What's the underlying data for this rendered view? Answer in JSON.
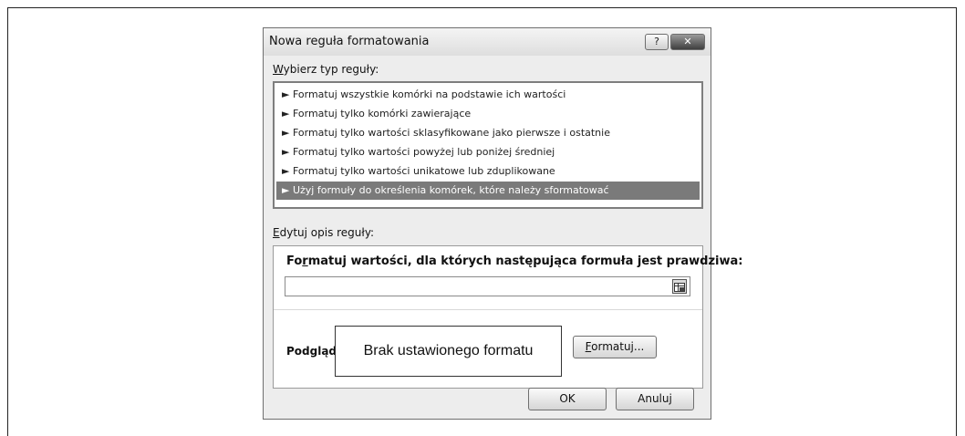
{
  "dialog": {
    "title": "Nowa reguła formatowania",
    "help_label": "?",
    "close_label": "✕"
  },
  "rule_type": {
    "label_accel": "W",
    "label_rest": "ybierz typ reguły:",
    "items": [
      "► Formatuj wszystkie komórki na podstawie ich wartości",
      "► Formatuj tylko komórki zawierające",
      "► Formatuj tylko wartości sklasyfikowane jako pierwsze i ostatnie",
      "► Formatuj tylko wartości powyżej lub poniżej średniej",
      "► Formatuj tylko wartości unikatowe lub zduplikowane",
      "► Użyj formuły do określenia komórek, które należy sformatować"
    ],
    "selected_index": 5
  },
  "description": {
    "label_accel": "E",
    "label_rest": "dytuj opis reguły:",
    "formula_title_pre": "Fo",
    "formula_title_accel": "r",
    "formula_title_rest": "matuj wartości, dla których następująca formuła jest prawdziwa:",
    "formula_value": "",
    "preview_label": "Podgląd:",
    "preview_text": "Brak ustawionego formatu",
    "format_button_accel": "F",
    "format_button_rest": "ormatuj..."
  },
  "buttons": {
    "ok": "OK",
    "cancel": "Anuluj"
  }
}
